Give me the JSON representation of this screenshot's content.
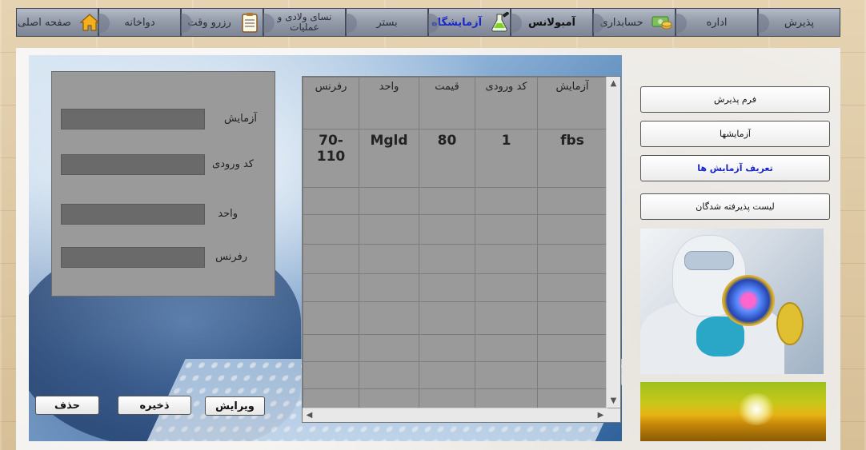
{
  "nav": {
    "items": [
      {
        "label": "پذیرش",
        "style": "normal"
      },
      {
        "label": "اداره",
        "style": "normal"
      },
      {
        "label": "حسابداری",
        "style": "normal",
        "icon": "money-icon"
      },
      {
        "label": "آمبولانس",
        "style": "active-dark"
      },
      {
        "label": "آزمایشگاه",
        "style": "active-blue",
        "icon": "lab-flask-icon"
      },
      {
        "label": "بستر",
        "style": "normal"
      },
      {
        "label": "نسای ولادی و عملیات",
        "style": "normal"
      },
      {
        "label": "رزرو وقت",
        "style": "normal",
        "icon": "notepad-icon"
      },
      {
        "label": "دواخانه",
        "style": "normal"
      },
      {
        "label": "صفحه اصلی",
        "style": "normal",
        "icon": "home-icon"
      }
    ]
  },
  "form": {
    "test_label": "آزمایش",
    "code_label": "کد ورودی",
    "unit_label": "واحد",
    "reference_label": "رفرنس",
    "test_value": "",
    "code_value": "",
    "unit_value": "",
    "reference_value": ""
  },
  "actions": {
    "edit_label": "ویرایش",
    "save_label": "ذخیره",
    "delete_label": "حذف"
  },
  "grid": {
    "columns": [
      "رفرنس",
      "واحد",
      "قیمت",
      "کد ورودی",
      "آزمایش"
    ],
    "rows": [
      [
        "70- 110",
        "Mgld",
        "80",
        "1",
        "fbs"
      ]
    ]
  },
  "sidebar": {
    "buttons": [
      {
        "label": "فرم پذیرش",
        "style": "normal"
      },
      {
        "label": "آزمایشها",
        "style": "normal"
      },
      {
        "label": "تعریف آزمایش ها",
        "style": "blue"
      },
      {
        "label": "لیست پذیرفته شدگان",
        "style": "normal"
      }
    ]
  },
  "colors": {
    "nav_active_blue": "#1a28c8",
    "grid_bg": "#9a9a9a",
    "form_bg": "#9a9a9a"
  }
}
